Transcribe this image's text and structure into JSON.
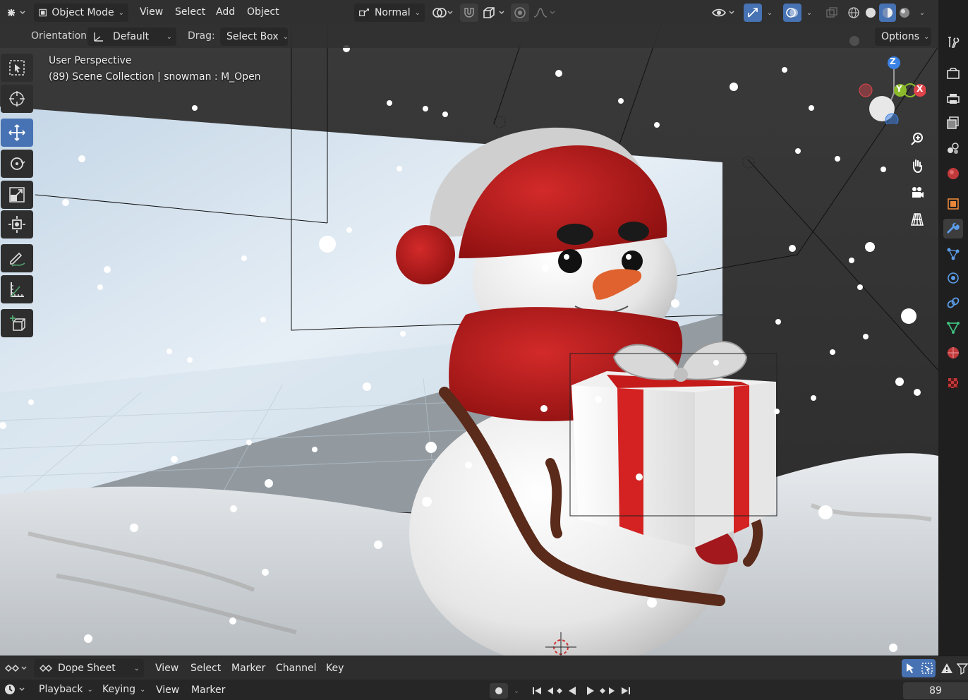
{
  "top_header": {
    "mode": "Object Mode",
    "menus": [
      "View",
      "Select",
      "Add",
      "Object"
    ],
    "transform_orientation": "Normal"
  },
  "tool_header": {
    "orientation_label": "Orientation:",
    "orientation_value": "Default",
    "drag_label": "Drag:",
    "drag_value": "Select Box",
    "options_label": "Options"
  },
  "viewport": {
    "view_name": "User Perspective",
    "scene_info": "(89) Scene Collection | snowman : M_Open"
  },
  "gizmo": {
    "z": "Z",
    "y": "Y",
    "x": "X"
  },
  "toolbar": [
    "select-box",
    "cursor",
    "move",
    "rotate",
    "scale",
    "transform",
    "annotate",
    "measure",
    "add-cube"
  ],
  "dope_sheet": {
    "editor": "Dope Sheet",
    "menus": [
      "View",
      "Select",
      "Marker",
      "Channel",
      "Key"
    ]
  },
  "timeline": {
    "playback_label": "Playback",
    "keying_label": "Keying",
    "view_label": "View",
    "marker_label": "Marker",
    "current_frame": "89"
  },
  "colors": {
    "accent": "#4772b3",
    "x_axis": "#e0444b",
    "y_axis": "#8bbb2b",
    "z_axis": "#3b82e5"
  }
}
